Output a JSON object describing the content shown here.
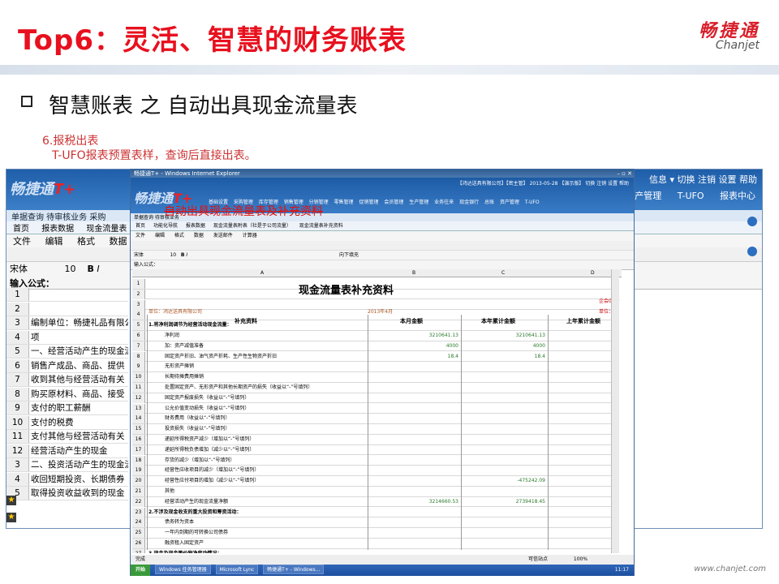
{
  "slide": {
    "title": "Top6：灵活、智慧的财务账表",
    "brand_cn": "畅捷通",
    "brand_en": "Chanjet",
    "subtitle": "智慧账表  之  自动出具现金流量表",
    "note_line1": "6.报税出表",
    "note_line2": "T-UFO报表预置表样，查询后直接出表。",
    "overlay_label": "自动出具现金流量表及补充资料",
    "footer_url": "www.chanjet.com"
  },
  "back_window": {
    "logo_text": "畅捷通",
    "logo_mark": "T+",
    "nav_right": "信息 ▾ 切换 注销 设置 帮助",
    "nav_items": "资产管理 T-UFO 报表中心",
    "quick_links": "单据查询  待审核业务  采购",
    "tabs": [
      "首页",
      "报表数据",
      "现金流量表"
    ],
    "menu": [
      "文件",
      "编辑",
      "格式",
      "数据"
    ],
    "font_name": "宋体",
    "font_size": "10",
    "formula_label": "输入公式：",
    "rows": [
      {
        "n": "1",
        "t": ""
      },
      {
        "n": "2",
        "t": ""
      },
      {
        "n": "3",
        "t": "编制单位：畅捷礼品有限公司"
      },
      {
        "n": "4",
        "t": "项"
      },
      {
        "n": "5",
        "t": "一、经营活动产生的现金流量："
      },
      {
        "n": "6",
        "t": "销售产成品、商品、提供"
      },
      {
        "n": "7",
        "t": "收到其他与经营活动有关"
      },
      {
        "n": "8",
        "t": "购买原材料、商品、接受"
      },
      {
        "n": "9",
        "t": "支付的职工薪酬"
      },
      {
        "n": "10",
        "t": "支付的税费"
      },
      {
        "n": "11",
        "t": "支付其他与经营活动有关"
      },
      {
        "n": "12",
        "t": "经营活动产生的现金"
      },
      {
        "n": "3",
        "t": "二、投资活动产生的现金流量："
      },
      {
        "n": "4",
        "t": "收回短期投资、长期债券"
      },
      {
        "n": "5",
        "t": "取得投资收益收到的现金"
      }
    ]
  },
  "front_window": {
    "title_bar": "畅捷通T+ - Windows Internet Explorer",
    "logo_text": "畅捷通",
    "logo_mark": "T+",
    "top_info": "【鸿达送具有限公司】【密主管】 2013-05-28 【演示版】 切换 注销 设置 帮助",
    "nav": "基础设置 采购管理 库存管理 销售管理 分销管理 零售管理 促销管理 会员管理 生产管理 业务往来 现金银行 总账 资产管理 T-UFO",
    "bar": "单据查询 待审核业务",
    "tabs": [
      "首页",
      "功能化导航",
      "报表数据",
      "现金流量表附表（社是于公司流量）",
      "现金流量表补充资料"
    ],
    "menu": [
      "文件",
      "编辑",
      "格式",
      "数据",
      "发送邮件",
      "计算器"
    ],
    "font_name": "宋体",
    "font_size": "10",
    "fill_label": "向下填充",
    "formula_label": "输入公式：",
    "col_headers": [
      "A",
      "B",
      "C",
      "D"
    ],
    "sheet_title": "现金流量表补充资料",
    "form_no": "企会03附",
    "unit_left": "单位：鸿达送具有限公司",
    "period": "2013年4月",
    "unit_right": "单位：元",
    "headers": [
      "补充资料",
      "本月金额",
      "本年累计金额",
      "上年累计金额"
    ],
    "rows": [
      {
        "n": "1",
        "a": "",
        "b": "",
        "c": "",
        "d": ""
      },
      {
        "n": "2",
        "a": "",
        "b": "",
        "c": "",
        "d": ""
      },
      {
        "n": "3",
        "a": "",
        "b": "",
        "c": "",
        "d": ""
      },
      {
        "n": "4",
        "a": "",
        "b": "",
        "c": "",
        "d": ""
      },
      {
        "n": "5",
        "a": "1.将净利润调节为经营活动现金流量：",
        "b": "",
        "c": "",
        "d": ""
      },
      {
        "n": "6",
        "a": "净利润",
        "b": "3210641.13",
        "c": "3210641.13",
        "d": ""
      },
      {
        "n": "7",
        "a": "加：资产减值准备",
        "b": "4000",
        "c": "4000",
        "d": ""
      },
      {
        "n": "8",
        "a": "固定资产折旧、油气资产折耗、生产性生物资产折旧",
        "b": "18.4",
        "c": "18.4",
        "d": ""
      },
      {
        "n": "9",
        "a": "无形资产摊销",
        "b": "",
        "c": "",
        "d": ""
      },
      {
        "n": "10",
        "a": "长期待摊费用摊销",
        "b": "",
        "c": "",
        "d": ""
      },
      {
        "n": "11",
        "a": "处置固定资产、无形资产和其他长期资产的损失（收益以“-”号填列）",
        "b": "",
        "c": "",
        "d": ""
      },
      {
        "n": "12",
        "a": "固定资产报废损失（收益以“-”号填列）",
        "b": "",
        "c": "",
        "d": ""
      },
      {
        "n": "13",
        "a": "公允价值变动损失（收益以“-”号填列）",
        "b": "",
        "c": "",
        "d": ""
      },
      {
        "n": "14",
        "a": "财务费用（收益以“-”号填列）",
        "b": "",
        "c": "",
        "d": ""
      },
      {
        "n": "15",
        "a": "投资损失（收益以“-”号填列）",
        "b": "",
        "c": "",
        "d": ""
      },
      {
        "n": "16",
        "a": "递延所得税资产减少（增加以“-”号填列）",
        "b": "",
        "c": "",
        "d": ""
      },
      {
        "n": "17",
        "a": "递延所得税负债增加（减少以“-”号填列）",
        "b": "",
        "c": "",
        "d": ""
      },
      {
        "n": "18",
        "a": "存货的减少（增加以“-”号填列）",
        "b": "",
        "c": "",
        "d": ""
      },
      {
        "n": "19",
        "a": "经营性应收项目的减少（增加以“-”号填列）",
        "b": "",
        "c": "",
        "d": ""
      },
      {
        "n": "20",
        "a": "经营性应付项目的增加（减少以“-”号填列）",
        "b": "",
        "c": "-475242.09",
        "d": ""
      },
      {
        "n": "21",
        "a": "其他",
        "b": "",
        "c": "",
        "d": ""
      },
      {
        "n": "22",
        "a": "经营活动产生的现金流量净额",
        "b": "3214660.53",
        "c": "2739418.45",
        "d": ""
      },
      {
        "n": "23",
        "a": "2.不涉及现金收支的重大投资和筹资活动：",
        "b": "",
        "c": "",
        "d": ""
      },
      {
        "n": "24",
        "a": "债务转为资本",
        "b": "",
        "c": "",
        "d": ""
      },
      {
        "n": "25",
        "a": "一年内到期的可转换公司债券",
        "b": "",
        "c": "",
        "d": ""
      },
      {
        "n": "26",
        "a": "融资租入固定资产",
        "b": "",
        "c": "",
        "d": ""
      },
      {
        "n": "27",
        "a": "3.现金及现金等价物净变动情况：",
        "b": "",
        "c": "",
        "d": ""
      }
    ],
    "status_left": "完成",
    "status_mid": "可信站点",
    "zoom": "100%",
    "taskbar": {
      "start": "开始",
      "items": [
        "Windows 任务管理器",
        "Microsoft Lync",
        "畅捷通T+ - Windows..."
      ],
      "clock": "11:17"
    }
  }
}
